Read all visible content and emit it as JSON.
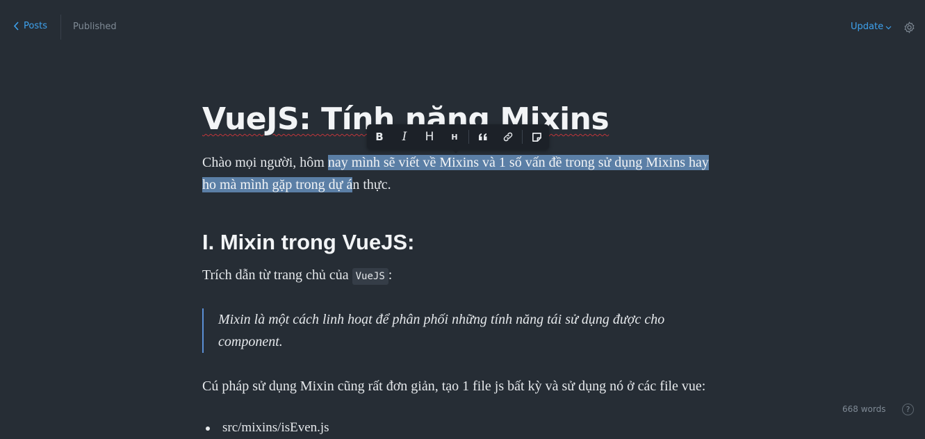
{
  "header": {
    "back_label": "Posts",
    "status": "Published",
    "update_label": "Update"
  },
  "post": {
    "title": "VueJS: Tính năng Mixins",
    "intro_before": "Chào mọi người, hôm ",
    "intro_selected": "nay mình sẽ viết về Mixins và 1 số vấn đề trong sử dụng Mixins hay ho mà mình gặp trong dự á",
    "intro_after": "n thực.",
    "heading": "I. Mixin trong VueJS:",
    "quote_prefix": "Trích dẫn từ trang chủ của ",
    "quote_code": "VueJS",
    "quote_suffix": ":",
    "blockquote": "Mixin là một cách linh hoạt để phân phối những tính năng tái sử dụng được cho component.",
    "syntax": "Cú pháp sử dụng Mixin cũng rất đơn giản, tạo 1 file js bất kỳ và sử dụng nó ở các file vue:",
    "list_items": [
      "src/mixins/isEven.js"
    ]
  },
  "toolbar": {
    "buttons": [
      "bold-icon",
      "italic-icon",
      "heading-large-icon",
      "heading-small-icon",
      "quote-icon",
      "link-icon",
      "snippet-icon"
    ],
    "bold": "B",
    "italic": "I",
    "h_large": "H",
    "h_small": "H"
  },
  "footer": {
    "word_count": "668 words",
    "help": "?"
  },
  "colors": {
    "background": "#262d35",
    "accent": "#3ea2ee",
    "selection": "#5b7fa6",
    "toolbar": "#1c2128"
  }
}
